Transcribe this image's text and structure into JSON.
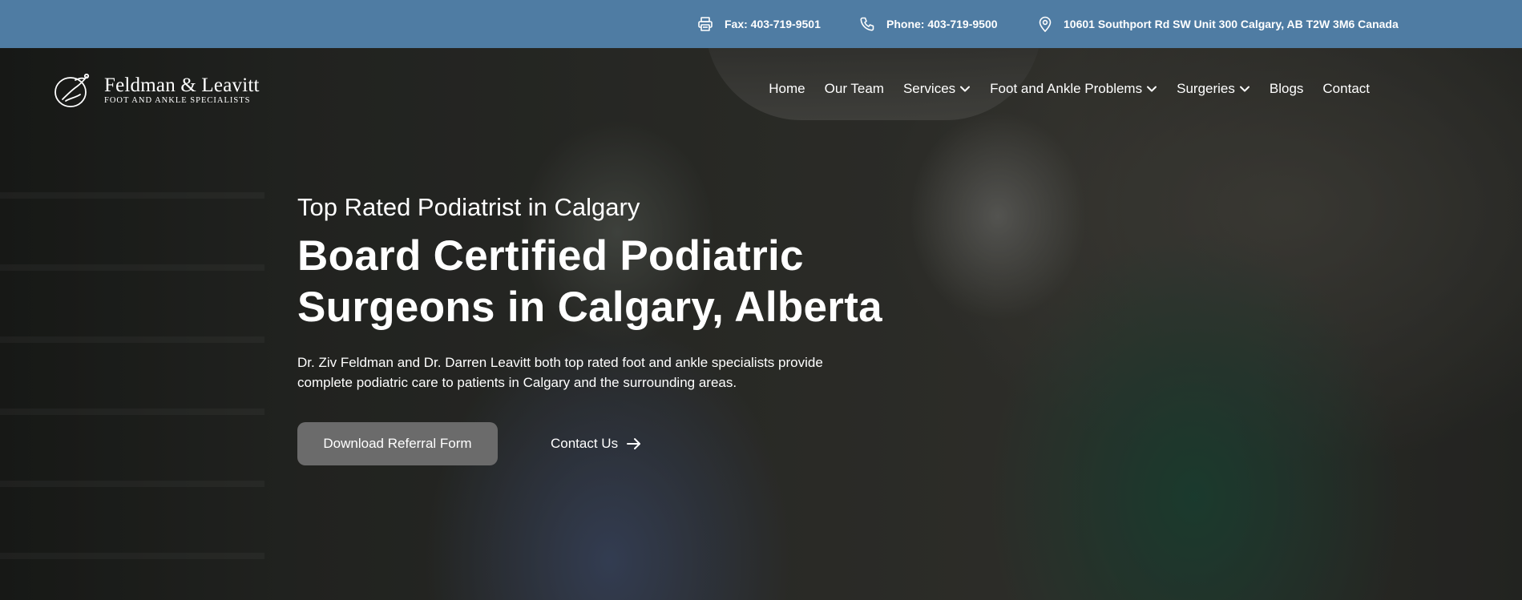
{
  "topbar": {
    "fax": "Fax: 403-719-9501",
    "phone": "Phone: 403-719-9500",
    "address": "10601 Southport Rd SW Unit 300 Calgary, AB T2W 3M6 Canada",
    "icons": [
      "printer-icon",
      "phone-icon",
      "location-pin-icon"
    ],
    "background_color": "#4f7ca3"
  },
  "logo": {
    "name": "Feldman & Leavitt",
    "tagline": "FOOT AND ANKLE SPECIALISTS"
  },
  "nav": {
    "items": [
      {
        "label": "Home",
        "dropdown": false
      },
      {
        "label": "Our Team",
        "dropdown": false
      },
      {
        "label": "Services",
        "dropdown": true
      },
      {
        "label": "Foot and Ankle Problems",
        "dropdown": true
      },
      {
        "label": "Surgeries",
        "dropdown": true
      },
      {
        "label": "Blogs",
        "dropdown": false
      },
      {
        "label": "Contact",
        "dropdown": false
      }
    ]
  },
  "hero": {
    "eyebrow": "Top Rated Podiatrist in Calgary",
    "headline_line1": "Board Certified Podiatric",
    "headline_line2": "Surgeons in Calgary, Alberta",
    "description_line1": "Dr. Ziv Feldman and Dr. Darren Leavitt both top rated foot and ankle specialists provide",
    "description_line2": "complete podiatric care to patients in Calgary and the surrounding areas.",
    "primary_button": "Download Referral Form",
    "secondary_button": "Contact Us",
    "primary_button_color": "#6b6b6b"
  }
}
